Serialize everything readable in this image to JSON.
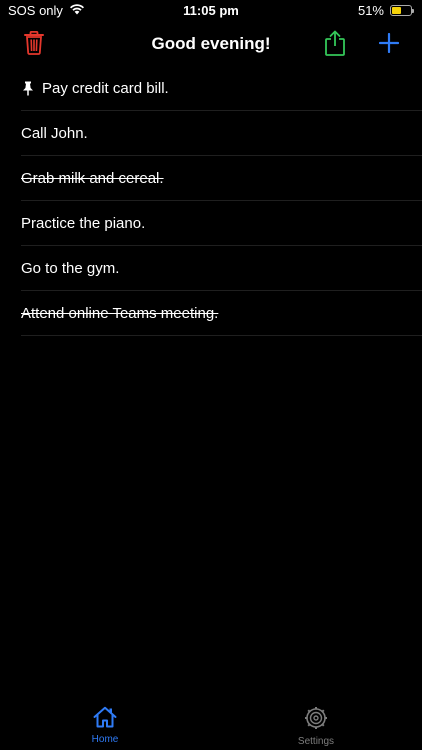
{
  "status_bar": {
    "carrier": "SOS only",
    "time": "11:05 pm",
    "battery": "51%",
    "battery_level": 0.51
  },
  "header": {
    "title": "Good evening!"
  },
  "colors": {
    "trash": "#e5372c",
    "share": "#34c759",
    "add": "#2f7bf6",
    "tab_active": "#2f7bf6",
    "tab_inactive": "#7d7d7d"
  },
  "tasks": [
    {
      "text": "Pay credit card bill.",
      "pinned": true,
      "done": false
    },
    {
      "text": "Call John.",
      "pinned": false,
      "done": false
    },
    {
      "text": "Grab milk and cereal.",
      "pinned": false,
      "done": true
    },
    {
      "text": "Practice the piano.",
      "pinned": false,
      "done": false
    },
    {
      "text": "Go to the gym.",
      "pinned": false,
      "done": false
    },
    {
      "text": "Attend online Teams meeting.",
      "pinned": false,
      "done": true
    }
  ],
  "tab_bar": {
    "home_label": "Home",
    "settings_label": "Settings"
  }
}
